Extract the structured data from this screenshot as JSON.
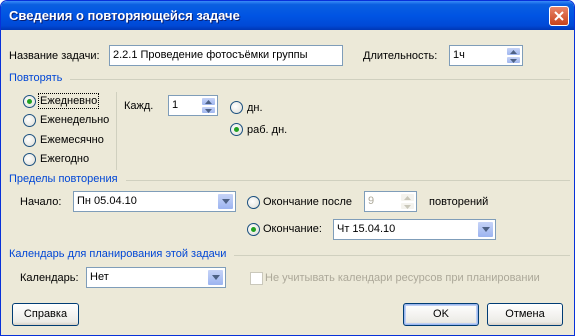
{
  "dialog": {
    "title": "Сведения о повторяющейся задаче"
  },
  "task": {
    "name_label": "Название задачи:",
    "name_value": "2.2.1 Проведение фотосъёмки группы",
    "duration_label": "Длительность:",
    "duration_value": "1ч"
  },
  "repeat": {
    "section_label": "Повторять",
    "options": [
      "Ежедневно",
      "Еженедельно",
      "Ежемесячно",
      "Ежегодно"
    ],
    "selected_index": 0,
    "every_label": "Кажд.",
    "every_value": "1",
    "unit_days": "дн.",
    "unit_workdays": "раб. дн."
  },
  "range": {
    "section_label": "Пределы повторения",
    "start_label": "Начало:",
    "start_value": "Пн 05.04.10",
    "end_after_label": "Окончание после",
    "end_after_value": "9",
    "occurrences_label": "повторений",
    "end_by_label": "Окончание:",
    "end_by_value": "Чт 15.04.10"
  },
  "calendar": {
    "section_label": "Календарь для планирования этой задачи",
    "calendar_label": "Календарь:",
    "calendar_value": "Нет",
    "ignore_resource_label": "Не учитывать календари ресурсов при планировании"
  },
  "buttons": {
    "help": "Справка",
    "ok": "OK",
    "cancel": "Отмена"
  },
  "colors": {
    "titlebar": "#0054e3",
    "section_text": "#0046d5",
    "dialog_bg": "#ece9d8"
  }
}
